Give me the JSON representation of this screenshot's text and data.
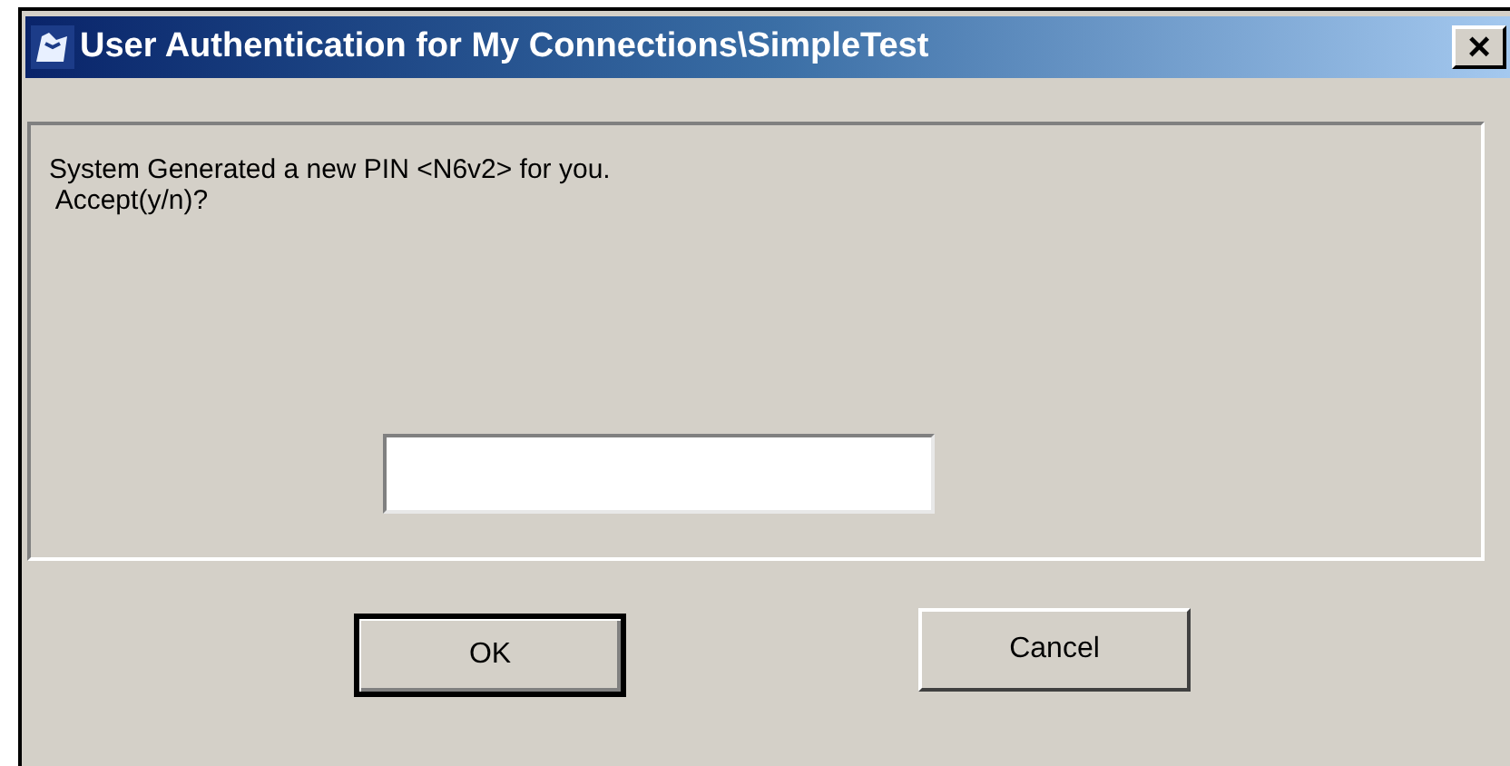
{
  "window": {
    "title": "User Authentication for My Connections\\SimpleTest",
    "close": "×"
  },
  "message": [
    "System Generated a new PIN <N6v2> for you.",
    " Accept(y/n)?"
  ],
  "buttons": [
    {
      "label": "OK",
      "default": true
    },
    {
      "label": "Cancel",
      "default": false
    }
  ]
}
